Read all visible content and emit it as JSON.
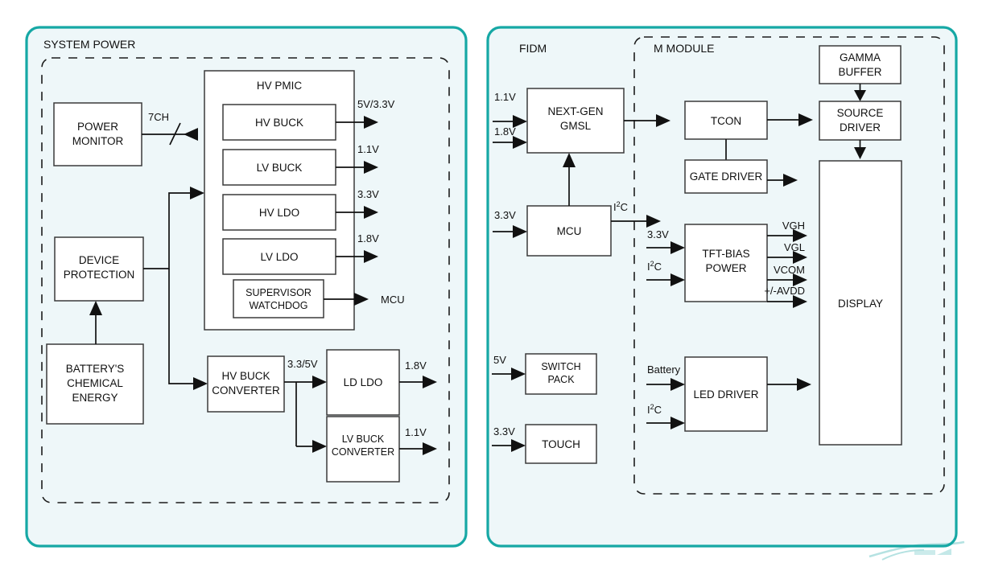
{
  "diagram": {
    "title": "System power and display module block diagram",
    "colors": {
      "panel_border": "#16a8a5",
      "panel_fill": "#eef7f9",
      "box_stroke": "#3a3a3a",
      "wire": "#111111"
    }
  },
  "panels": [
    {
      "id": "system_power",
      "label": "SYSTEM POWER"
    },
    {
      "id": "fidm",
      "label": "FIDM"
    },
    {
      "id": "m_module",
      "label": "M MODULE"
    }
  ],
  "blocks": {
    "power_monitor": "POWER\nMONITOR",
    "power_monitor_l1": "POWER",
    "power_monitor_l2": "MONITOR",
    "device_protection_l1": "DEVICE",
    "device_protection_l2": "PROTECTION",
    "battery_l1": "BATTERY'S",
    "battery_l2": "CHEMICAL",
    "battery_l3": "ENERGY",
    "hv_pmic": "HV PMIC",
    "hv_buck": "HV BUCK",
    "lv_buck": "LV BUCK",
    "hv_ldo": "HV LDO",
    "lv_ldo": "LV LDO",
    "supervisor_l1": "SUPERVISOR",
    "supervisor_l2": "WATCHDOG",
    "hv_buck_conv_l1": "HV BUCK",
    "hv_buck_conv_l2": "CONVERTER",
    "ld_ldo": "LD LDO",
    "lv_buck_conv_l1": "LV BUCK",
    "lv_buck_conv_l2": "CONVERTER",
    "next_gen_gmsl_l1": "NEXT-GEN",
    "next_gen_gmsl_l2": "GMSL",
    "mcu": "MCU",
    "switch_pack_l1": "SWITCH",
    "switch_pack_l2": "PACK",
    "touch": "TOUCH",
    "gamma_buffer_l1": "GAMMA",
    "gamma_buffer_l2": "BUFFER",
    "source_driver_l1": "SOURCE",
    "source_driver_l2": "DRIVER",
    "tcon": "TCON",
    "gate_driver": "GATE DRIVER",
    "tft_bias_l1": "TFT-BIAS",
    "tft_bias_l2": "POWER",
    "led_driver": "LED DRIVER",
    "display": "DISPLAY"
  },
  "signals": {
    "ch7": "7CH",
    "v5_3v3": "5V/3.3V",
    "v1v1_a": "1.1V",
    "v3v3_a": "3.3V",
    "v1v8_a": "1.8V",
    "mcu_out": "MCU",
    "v3v3_5v": "3.3/5V",
    "v1v8_b": "1.8V",
    "v1v1_b": "1.1V",
    "in_1v1": "1.1V",
    "in_1v8": "1.8V",
    "in_3v3_mcu": "3.3V",
    "i2c_mcu": "I",
    "i2c_mcu_sup": "2",
    "i2c_mcu_tail": "C",
    "in_5v": "5V",
    "in_3v3_touch": "3.3V",
    "tft_in_3v3": "3.3V",
    "tft_in_i2c": "I²C",
    "vgh": "VGH",
    "vgl": "VGL",
    "vcom": "VCOM",
    "avdd": "+/-AVDD",
    "battery_in": "Battery",
    "led_i2c": "I²C"
  }
}
